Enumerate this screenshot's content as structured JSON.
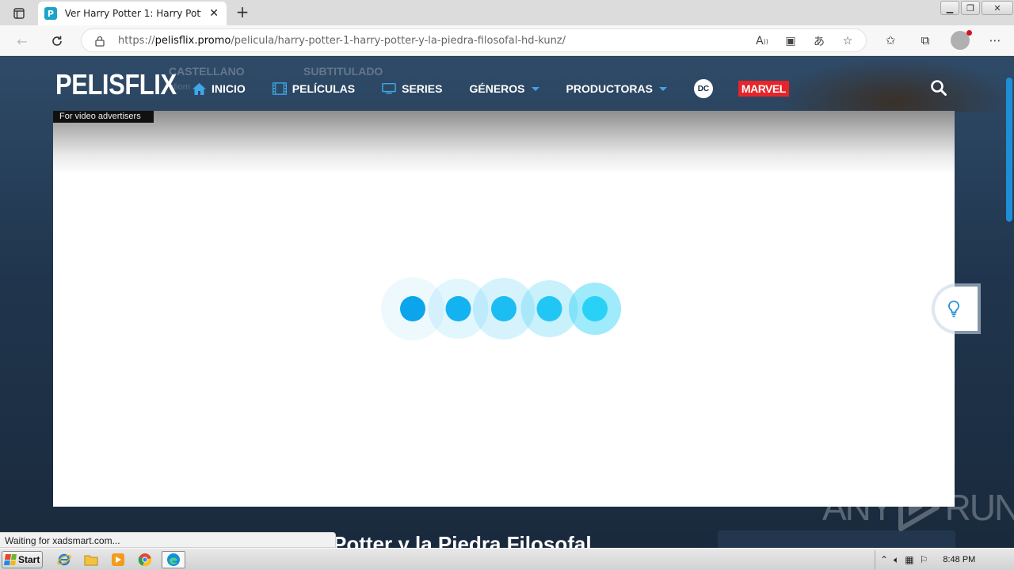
{
  "browser": {
    "tab_title": "Ver Harry Potter 1: Harry Potter y",
    "favicon_letter": "P",
    "url_prefix": "https://",
    "url_domain": "pelisflix.promo",
    "url_path": "/pelicula/harry-potter-1-harry-potter-y-la-piedra-filosofal-hd-kunz/"
  },
  "site": {
    "logo": "PELISFLIX",
    "nav": {
      "inicio": "INICIO",
      "peliculas": "PELÍCULAS",
      "series": "SERIES",
      "generos": "GÉNEROS",
      "productoras": "PRODUCTORAS",
      "dc": "DC",
      "marvel": "MARVEL"
    },
    "bg_ghost": {
      "castellano": "CASTELLANO",
      "subtitulado": "SUBTITULADO",
      "idioma": "Idiom"
    },
    "page_title": "Potter y la Piedra Filosofal"
  },
  "ad": {
    "label": "For video advertisers",
    "loader_colors": [
      "#0ba5ec",
      "#14b2f0",
      "#1cbdf2",
      "#22c6f4",
      "#2ad1f6"
    ]
  },
  "status": {
    "text": "Waiting for xadsmart.com..."
  },
  "watermark": {
    "left": "ANY",
    "right": "RUN"
  },
  "taskbar": {
    "start": "Start",
    "time": "8:48 PM"
  },
  "colors": {
    "accent": "#3fa7e8",
    "marvel_red": "#e62429",
    "page_bg": "#1c2d40"
  }
}
